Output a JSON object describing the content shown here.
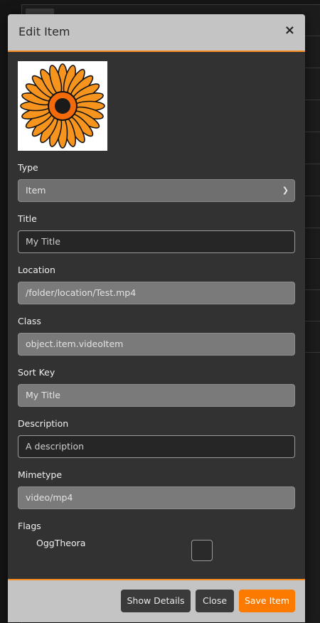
{
  "modal": {
    "title": "Edit Item",
    "close_symbol": "×",
    "thumbnail_icon": "orange-daisy-thumbnail"
  },
  "fields": {
    "type": {
      "label": "Type",
      "value": "Item"
    },
    "title": {
      "label": "Title",
      "value": "My Title"
    },
    "location": {
      "label": "Location",
      "value": "/folder/location/Test.mp4"
    },
    "class": {
      "label": "Class",
      "value": "object.item.videoItem"
    },
    "sort_key": {
      "label": "Sort Key",
      "value": "My Title"
    },
    "description": {
      "label": "Description",
      "value": "A description"
    },
    "mimetype": {
      "label": "Mimetype",
      "value": "video/mp4"
    },
    "flags": {
      "label": "Flags",
      "items": [
        {
          "name": "OggTheora",
          "checked": false
        }
      ]
    }
  },
  "footer": {
    "show_details": "Show Details",
    "close": "Close",
    "save": "Save Item"
  },
  "colors": {
    "accent": "#f78d1e",
    "save_button": "#fc7a00",
    "header_bg": "#c4c4c4",
    "body_bg": "#323232"
  }
}
